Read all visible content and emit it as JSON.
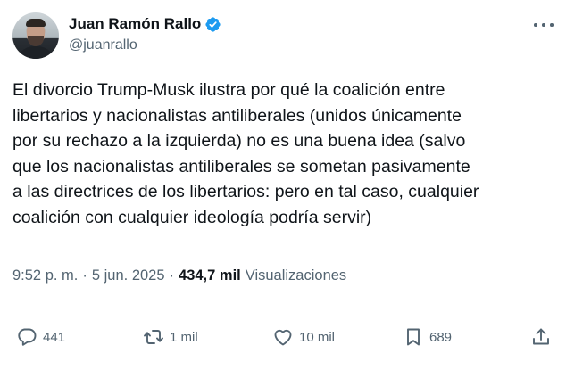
{
  "author": {
    "display_name": "Juan Ramón Rallo",
    "handle": "@juanrallo",
    "verified": true,
    "verified_color": "#1d9bf0"
  },
  "tweet": {
    "text": "El divorcio Trump-Musk ilustra por qué la coalición entre\nlibertarios y nacionalistas antiliberales (unidos únicamente\npor su rechazo a la izquierda) no es una buena idea (salvo\nque los nacionalistas antiliberales se sometan pasivamente\na las directrices de los libertarios: pero en tal caso, cualquier\ncoalición con cualquier ideología podría servir)",
    "time": "9:52 p. m.",
    "date": "5 jun. 2025",
    "views_count": "434,7 mil",
    "views_label": "Visualizaciones"
  },
  "actions": {
    "replies": "441",
    "retweets": "1 mil",
    "likes": "10 mil",
    "bookmarks": "689"
  },
  "icons": {
    "more": "more-icon",
    "reply": "reply-icon",
    "retweet": "retweet-icon",
    "like": "heart-icon",
    "bookmark": "bookmark-icon",
    "share": "share-icon",
    "verified": "verified-badge-icon"
  },
  "colors": {
    "text_primary": "#0f1419",
    "text_secondary": "#536471",
    "divider": "#eff3f4"
  }
}
